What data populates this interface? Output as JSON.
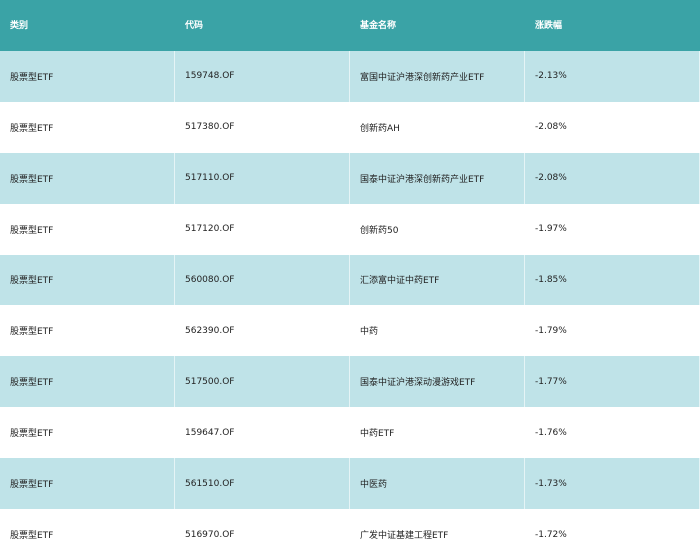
{
  "table": {
    "headers": [
      "类别",
      "代码",
      "基金名称",
      "涨跌幅"
    ],
    "rows": [
      [
        "股票型ETF",
        "159748.OF",
        "富国中证沪港深创新药产业ETF",
        "-2.13%"
      ],
      [
        "股票型ETF",
        "517380.OF",
        "创新药AH",
        "-2.08%"
      ],
      [
        "股票型ETF",
        "517110.OF",
        "国泰中证沪港深创新药产业ETF",
        "-2.08%"
      ],
      [
        "股票型ETF",
        "517120.OF",
        "创新药50",
        "-1.97%"
      ],
      [
        "股票型ETF",
        "560080.OF",
        "汇添富中证中药ETF",
        "-1.85%"
      ],
      [
        "股票型ETF",
        "562390.OF",
        "中药",
        "-1.79%"
      ],
      [
        "股票型ETF",
        "517500.OF",
        "国泰中证沪港深动漫游戏ETF",
        "-1.77%"
      ],
      [
        "股票型ETF",
        "159647.OF",
        "中药ETF",
        "-1.76%"
      ],
      [
        "股票型ETF",
        "561510.OF",
        "中医药",
        "-1.73%"
      ],
      [
        "股票型ETF",
        "516970.OF",
        "广发中证基建工程ETF",
        "-1.72%"
      ]
    ]
  },
  "colors": {
    "header_bg": "#3aa3a6",
    "stripe_bg": "#bfe3e8",
    "row_bg": "#ffffff"
  }
}
